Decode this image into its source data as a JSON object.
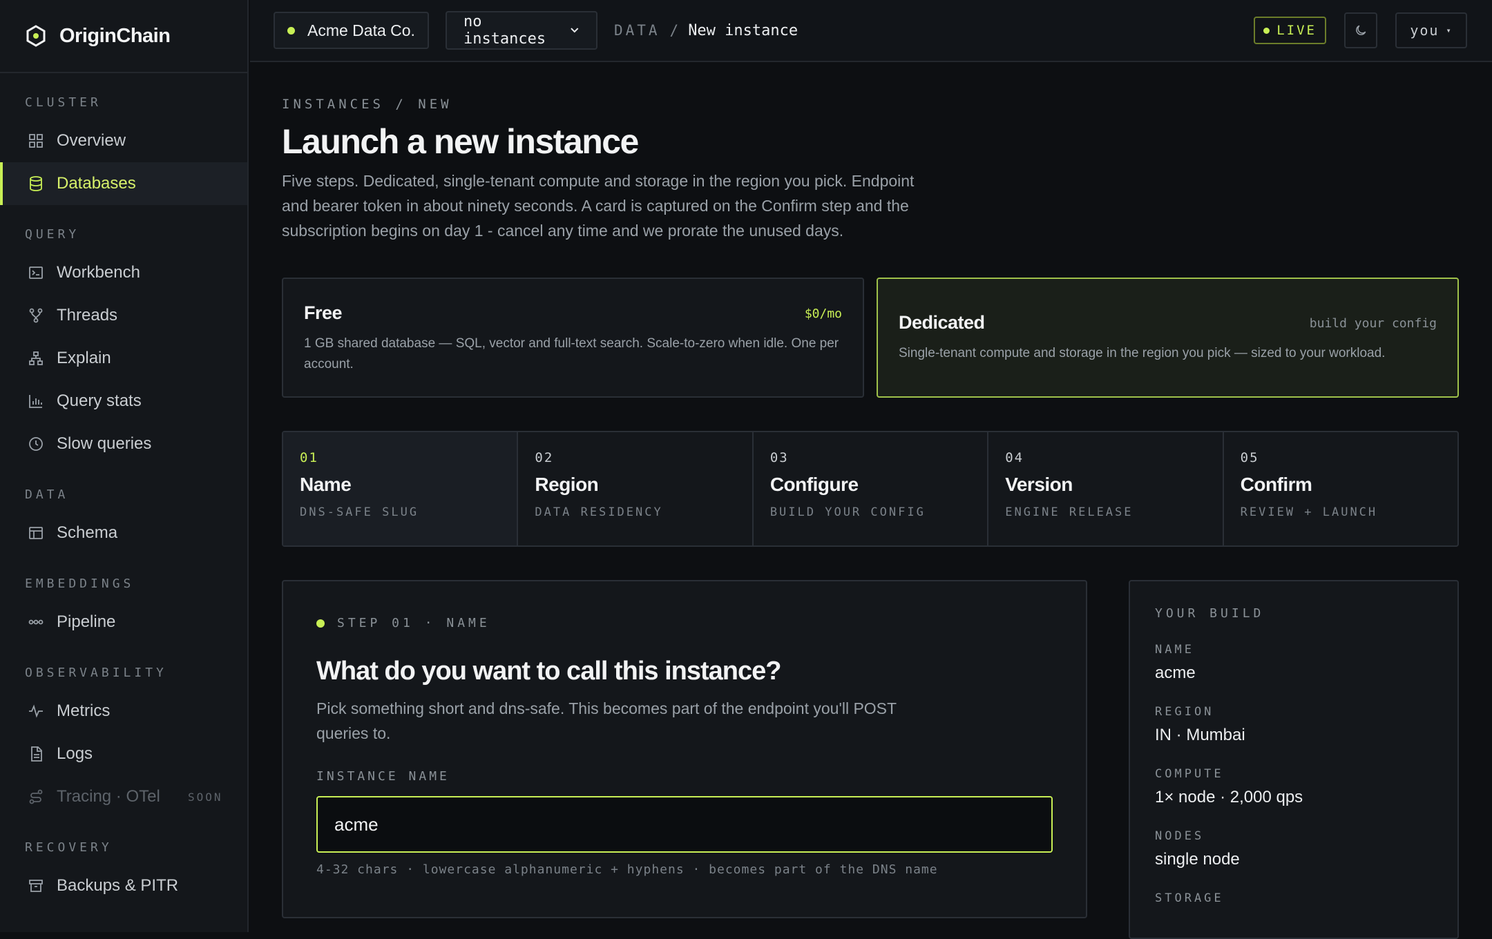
{
  "brand": {
    "name": "OriginChain"
  },
  "sidebar": {
    "sections": [
      {
        "label": "CLUSTER",
        "items": [
          {
            "label": "Overview",
            "icon": "grid-icon"
          },
          {
            "label": "Databases",
            "icon": "database-icon",
            "active": true
          }
        ]
      },
      {
        "label": "QUERY",
        "items": [
          {
            "label": "Workbench",
            "icon": "terminal-icon"
          },
          {
            "label": "Threads",
            "icon": "branch-icon"
          },
          {
            "label": "Explain",
            "icon": "tree-icon"
          },
          {
            "label": "Query stats",
            "icon": "bar-chart-icon"
          },
          {
            "label": "Slow queries",
            "icon": "clock-icon"
          }
        ]
      },
      {
        "label": "DATA",
        "items": [
          {
            "label": "Schema",
            "icon": "table-icon"
          }
        ]
      },
      {
        "label": "EMBEDDINGS",
        "items": [
          {
            "label": "Pipeline",
            "icon": "pipeline-icon"
          }
        ]
      },
      {
        "label": "OBSERVABILITY",
        "items": [
          {
            "label": "Metrics",
            "icon": "pulse-icon"
          },
          {
            "label": "Logs",
            "icon": "file-icon"
          },
          {
            "label": "Tracing · OTel",
            "icon": "trace-icon",
            "disabled": true,
            "badge": "SOON"
          }
        ]
      },
      {
        "label": "RECOVERY",
        "items": [
          {
            "label": "Backups & PITR",
            "icon": "archive-icon"
          }
        ]
      }
    ]
  },
  "topbar": {
    "org": "Acme Data Co.",
    "instance_select": "no instances",
    "crumb_root": "DATA",
    "crumb_sep": "/",
    "crumb_current": "New instance",
    "live_label": "LIVE",
    "user_label": "you",
    "user_caret": "▾"
  },
  "page": {
    "kicker": "INSTANCES / NEW",
    "title": "Launch a new instance",
    "lede": "Five steps. Dedicated, single-tenant compute and storage in the region you pick. Endpoint and bearer token in about ninety seconds. A card is captured on the Confirm step and the subscription begins on day 1 - cancel any time and we prorate the unused days."
  },
  "plans": [
    {
      "name": "Free",
      "price": "$0/mo",
      "desc": "1 GB shared database — SQL, vector and full-text search. Scale-to-zero when idle. One per account.",
      "selected": false
    },
    {
      "name": "Dedicated",
      "price": "build your config",
      "desc": "Single-tenant compute and storage in the region you pick — sized to your workload.",
      "selected": true
    }
  ],
  "steps": [
    {
      "num": "01",
      "name": "Name",
      "sub": "DNS-SAFE SLUG",
      "active": true
    },
    {
      "num": "02",
      "name": "Region",
      "sub": "DATA RESIDENCY"
    },
    {
      "num": "03",
      "name": "Configure",
      "sub": "BUILD YOUR CONFIG"
    },
    {
      "num": "04",
      "name": "Version",
      "sub": "ENGINE RELEASE"
    },
    {
      "num": "05",
      "name": "Confirm",
      "sub": "REVIEW + LAUNCH"
    }
  ],
  "form": {
    "step_tag": "STEP 01 · NAME",
    "question": "What do you want to call this instance?",
    "desc": "Pick something short and dns-safe. This becomes part of the endpoint you'll POST queries to.",
    "field_label": "INSTANCE NAME",
    "value": "acme",
    "hint": "4-32 chars · lowercase alphanumeric + hyphens · becomes part of the DNS name"
  },
  "build": {
    "title": "YOUR BUILD",
    "rows": [
      {
        "k": "NAME",
        "v": "acme"
      },
      {
        "k": "REGION",
        "v": "IN · Mumbai"
      },
      {
        "k": "COMPUTE",
        "v": "1× node · 2,000 qps"
      },
      {
        "k": "NODES",
        "v": "single node"
      },
      {
        "k": "STORAGE",
        "v": ""
      }
    ]
  },
  "colors": {
    "accent": "#c8ef55",
    "bg": "#0d0f12",
    "panel": "#14171b",
    "border": "#2a2f36"
  }
}
